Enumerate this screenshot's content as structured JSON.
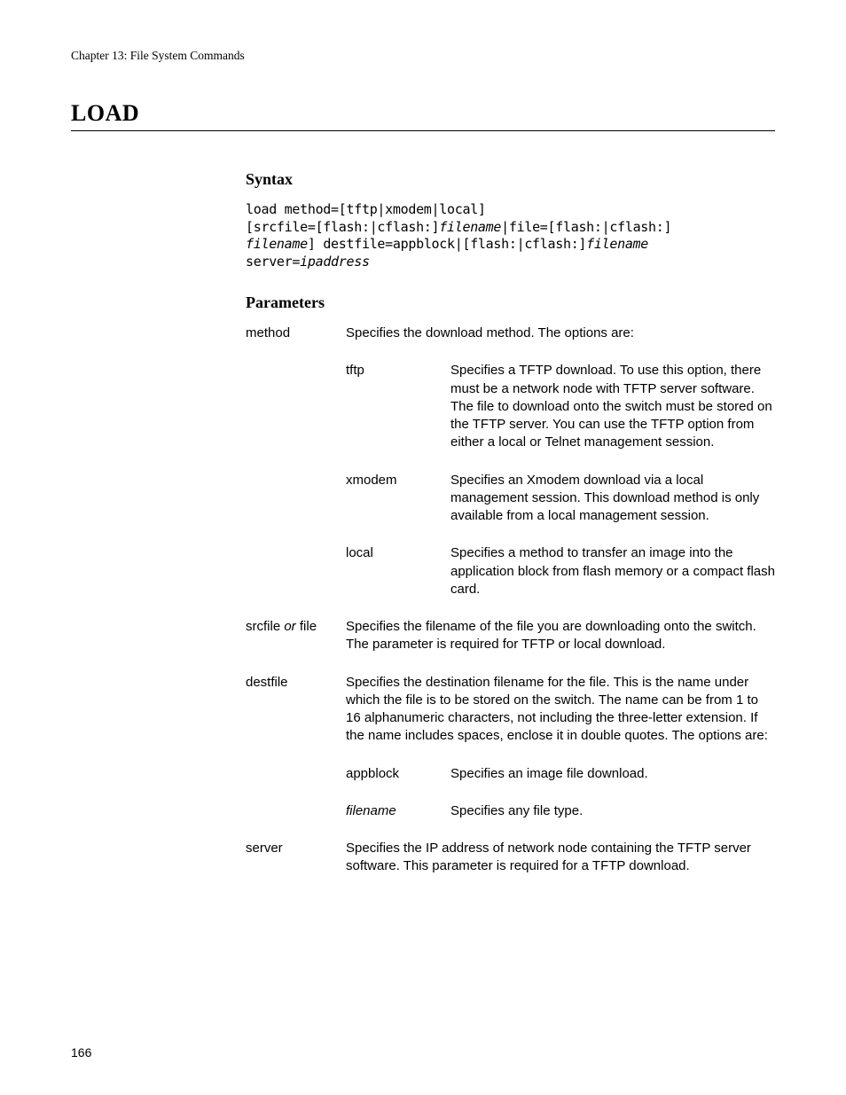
{
  "header": {
    "chapter": "Chapter 13: File System Commands",
    "title": "LOAD"
  },
  "sections": {
    "syntax_heading": "Syntax",
    "parameters_heading": "Parameters"
  },
  "syntax": {
    "p1": "load method=[tftp|xmodem|local]",
    "p2a": "[srcfile=[flash:|cflash:]",
    "p2b_it": "filename",
    "p2c": "|file=[flash:|cflash:]",
    "p3a_it": "filename",
    "p3b": "] destfile=appblock|[flash:|cflash:]",
    "p3c_it": "filename",
    "p4a": "server=",
    "p4b_it": "ipaddress"
  },
  "params": {
    "method": {
      "name": "method",
      "desc": "Specifies the download method. The options are:",
      "subs": {
        "tftp": {
          "name": "tftp",
          "desc": "Specifies a TFTP download. To use this option, there must be a network node with TFTP server software. The file to download onto the switch must be stored on the TFTP server. You can use the TFTP option from either a local or Telnet management session."
        },
        "xmodem": {
          "name": "xmodem",
          "desc": "Specifies an Xmodem download via a local management session. This download method is only available from a local management session."
        },
        "local": {
          "name": "local",
          "desc": "Specifies a method to transfer an image into the application block from flash memory or a compact flash card."
        }
      }
    },
    "srcfile": {
      "name_a": "srcfile ",
      "name_or_it": "or",
      "name_b": " file",
      "desc": "Specifies the filename of the file you are downloading onto the switch. The parameter is required for TFTP or local download."
    },
    "destfile": {
      "name": "destfile",
      "desc": "Specifies the destination filename for the file. This is the name under which the file is to be stored on the switch. The name can be from 1 to 16 alphanumeric characters, not including the three-letter extension. If the name includes spaces, enclose it in double quotes. The options are:",
      "subs": {
        "appblock": {
          "name": "appblock",
          "desc": "Specifies an image file download."
        },
        "filename": {
          "name_it": "filename",
          "desc": "Specifies any file type."
        }
      }
    },
    "server": {
      "name": "server",
      "desc": "Specifies the IP address of network node containing the TFTP server software. This parameter is required for a TFTP download."
    }
  },
  "footer": {
    "page_number": "166"
  }
}
